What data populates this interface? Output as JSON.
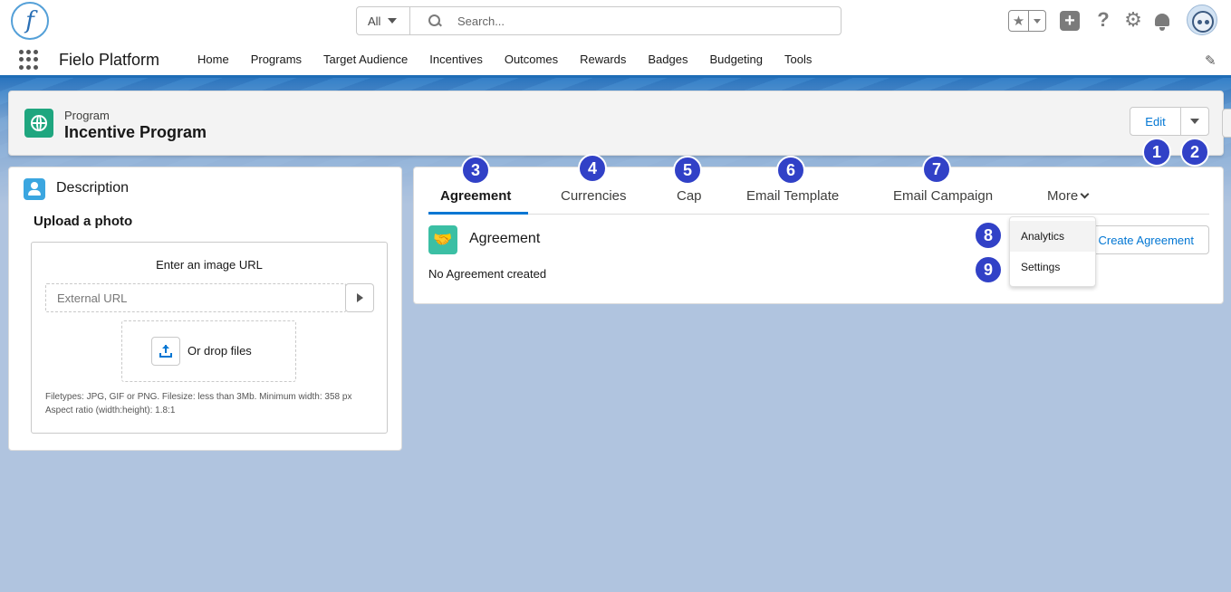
{
  "header": {
    "logo_text": "f",
    "search_scope": "All",
    "search_placeholder": "Search...",
    "icons": [
      "favorites-star-icon",
      "plus-icon",
      "help-icon",
      "gear-icon",
      "bell-icon",
      "avatar"
    ]
  },
  "nav": {
    "app_name": "Fielo Platform",
    "items": [
      "Home",
      "Programs",
      "Target Audience",
      "Incentives",
      "Outcomes",
      "Rewards",
      "Badges",
      "Budgeting",
      "Tools"
    ]
  },
  "record": {
    "type": "Program",
    "title": "Incentive Program",
    "edit_label": "Edit"
  },
  "badges": [
    "1",
    "2",
    "3",
    "4",
    "5",
    "6",
    "7",
    "8",
    "9"
  ],
  "description_card": {
    "title": "Description",
    "upload_title": "Upload a photo",
    "url_label": "Enter an image URL",
    "url_placeholder": "External URL",
    "drop_text": "Or drop files",
    "hint_line1": "Filetypes: JPG, GIF or PNG. Filesize: less than 3Mb. Minimum width: 358 px",
    "hint_line2": "Aspect ratio (width:height): 1.8:1"
  },
  "tabs_card": {
    "tabs": [
      "Agreement",
      "Currencies",
      "Cap",
      "Email Template",
      "Email Campaign"
    ],
    "more_label": "More",
    "active_tab": "Agreement",
    "section_title": "Agreement",
    "empty_text": "No Agreement created",
    "create_label": "Create Agreement"
  },
  "more_menu": {
    "items": [
      "Analytics",
      "Settings"
    ]
  },
  "colors": {
    "brand_blue": "#0176d3",
    "badge": "#3141c7",
    "program_icon": "#1fa67f",
    "agreement_icon": "#3bbfa4",
    "background": "#b0c4df"
  }
}
